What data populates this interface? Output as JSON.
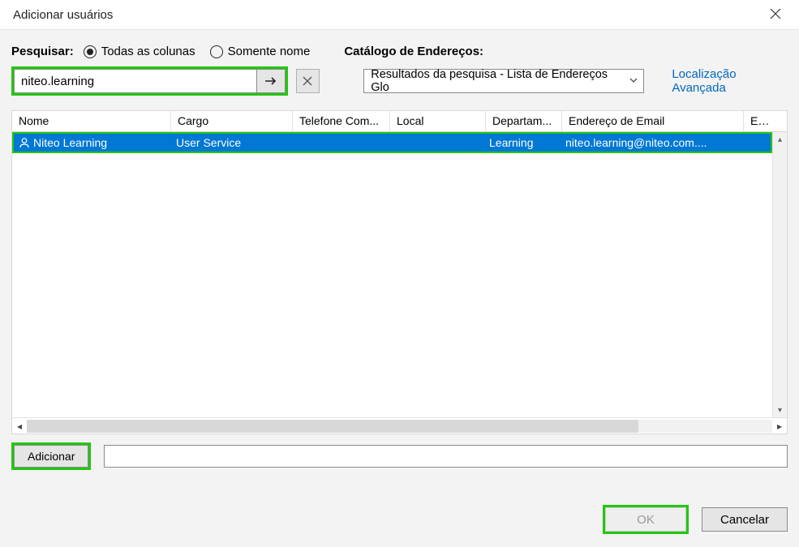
{
  "title": "Adicionar usuários",
  "search_label": "Pesquisar:",
  "radio_all": "Todas as colunas",
  "radio_name": "Somente nome",
  "catalog_label": "Catálogo de Endereços:",
  "search_value": "niteo.learning",
  "catalog_value": "Resultados da pesquisa - Lista de Endereços Glo",
  "advanced_link": "Localização Avançada",
  "columns": {
    "nome": "Nome",
    "cargo": "Cargo",
    "tel": "Telefone Com...",
    "local": "Local",
    "dep": "Departam...",
    "email": "Endereço de Email",
    "empresa": "Empresa"
  },
  "rows": [
    {
      "nome": "Niteo Learning",
      "cargo": "User Service",
      "tel": "",
      "local": "",
      "dep": "Learning",
      "email": "niteo.learning@niteo.com....",
      "empresa": ""
    }
  ],
  "add_button": "Adicionar",
  "add_field_value": "",
  "ok_button": "OK",
  "cancel_button": "Cancelar",
  "highlight_color": "#22c70f",
  "selection_color": "#0078d4"
}
